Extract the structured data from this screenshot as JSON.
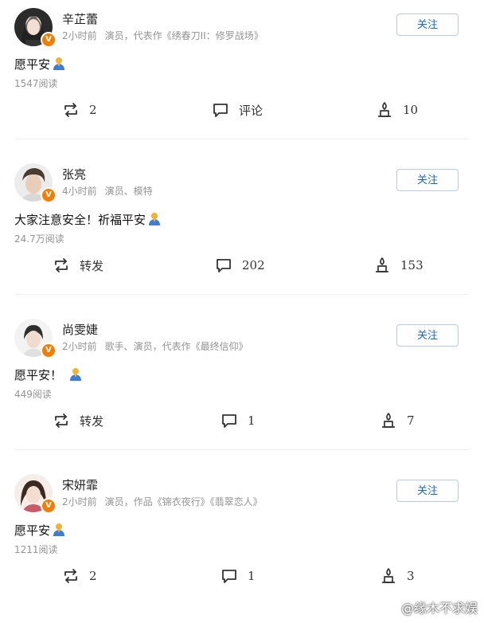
{
  "posts": [
    {
      "name": "辛芷蕾",
      "time": "2小时前",
      "desc": "演员，代表作《绣春刀II：修罗战场》",
      "follow": "关注",
      "content": "愿平安",
      "reads": "1547阅读",
      "repost": "2",
      "comment": "评论",
      "like": "10"
    },
    {
      "name": "张亮",
      "time": "4小时前",
      "desc": "演员、模特",
      "follow": "关注",
      "content": "大家注意安全！祈福平安",
      "reads": "24.7万阅读",
      "repost": "转发",
      "comment": "202",
      "like": "153"
    },
    {
      "name": "尚雯婕",
      "time": "2小时前",
      "desc": "歌手、演员，代表作《最终信仰》",
      "follow": "关注",
      "content": "愿平安！",
      "reads": "449阅读",
      "repost": "转发",
      "comment": "1",
      "like": "7"
    },
    {
      "name": "宋妍霏",
      "time": "2小时前",
      "desc": "演员，作品《锦衣夜行》《翡翠恋人》",
      "follow": "关注",
      "content": "愿平安",
      "reads": "1211阅读",
      "repost": "2",
      "comment": "1",
      "like": "3"
    }
  ],
  "watermark": "@缘木不求娱",
  "colors": {
    "accent": "#1a66c7",
    "badge": "#f57c00",
    "muted": "#939393"
  },
  "icons": [
    "repost-icon",
    "comment-icon",
    "candle-like-icon",
    "pray-emoji"
  ]
}
